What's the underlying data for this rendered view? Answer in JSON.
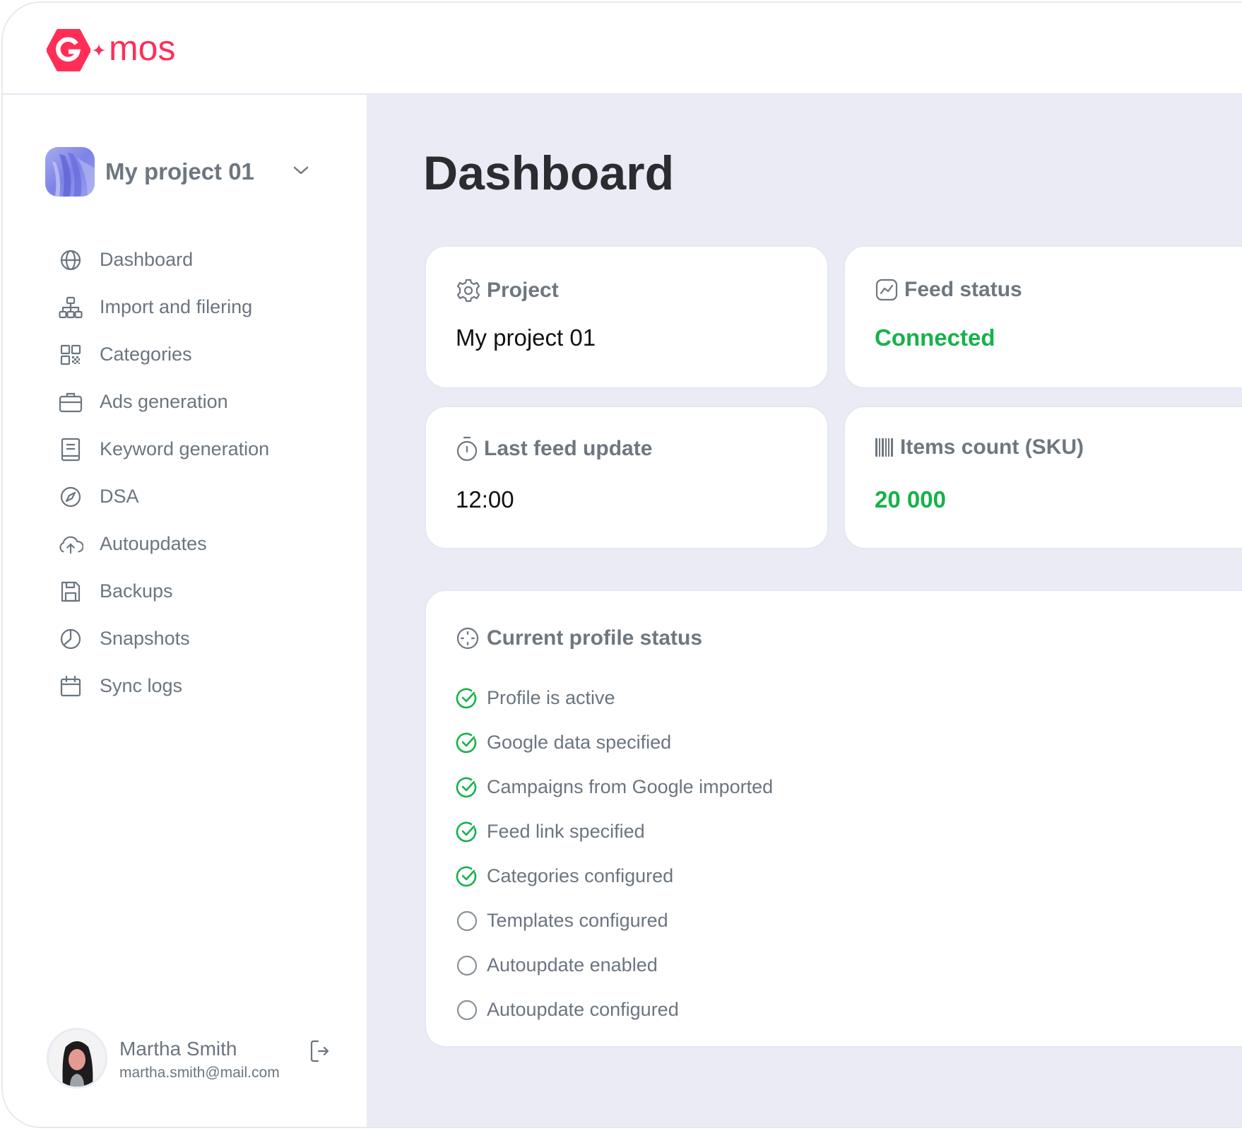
{
  "brand": {
    "name": "mos",
    "logo_letter": "G",
    "color": "#FF2E57"
  },
  "project_selector": {
    "name": "My project 01",
    "icon": "chevron-down-icon"
  },
  "sidebar": {
    "items": [
      {
        "label": "Dashboard",
        "icon": "globe-icon"
      },
      {
        "label": "Import and filering",
        "icon": "sitemap-icon"
      },
      {
        "label": "Categories",
        "icon": "qr-grid-icon"
      },
      {
        "label": "Ads generation",
        "icon": "briefcase-icon"
      },
      {
        "label": "Keyword generation",
        "icon": "book-icon"
      },
      {
        "label": "DSA",
        "icon": "compass-icon"
      },
      {
        "label": "Autoupdates",
        "icon": "cloud-upload-icon"
      },
      {
        "label": "Backups",
        "icon": "floppy-icon"
      },
      {
        "label": "Snapshots",
        "icon": "pie-chart-icon"
      },
      {
        "label": "Sync logs",
        "icon": "calendar-icon"
      }
    ]
  },
  "user": {
    "name": "Martha Smith",
    "email": "martha.smith@mail.com",
    "logout_icon": "logout-icon"
  },
  "main": {
    "title": "Dashboard",
    "cards": {
      "project": {
        "label": "Project",
        "value": "My project 01",
        "icon": "gear-icon"
      },
      "feed_status": {
        "label": "Feed status",
        "value": "Connected",
        "icon": "chart-line-icon"
      },
      "last_update": {
        "label": "Last feed update",
        "value": "12:00",
        "icon": "stopwatch-icon"
      },
      "items_count": {
        "label": "Items count (SKU)",
        "value": "20 000",
        "icon": "barcode-icon"
      }
    },
    "profile_status": {
      "title": "Current profile status",
      "icon": "target-icon",
      "items": [
        {
          "label": "Profile is active",
          "done": true
        },
        {
          "label": "Google data specified",
          "done": true
        },
        {
          "label": "Campaigns from Google imported",
          "done": true
        },
        {
          "label": "Feed link specified",
          "done": true
        },
        {
          "label": "Categories configured",
          "done": true
        },
        {
          "label": "Templates configured",
          "done": false
        },
        {
          "label": "Autoupdate enabled",
          "done": false
        },
        {
          "label": "Autoupdate configured",
          "done": false
        }
      ]
    }
  },
  "colors": {
    "success": "#16B24B",
    "muted_text": "#6E7780",
    "page_bg": "#EBEBF6",
    "pending": "#8A939B"
  }
}
